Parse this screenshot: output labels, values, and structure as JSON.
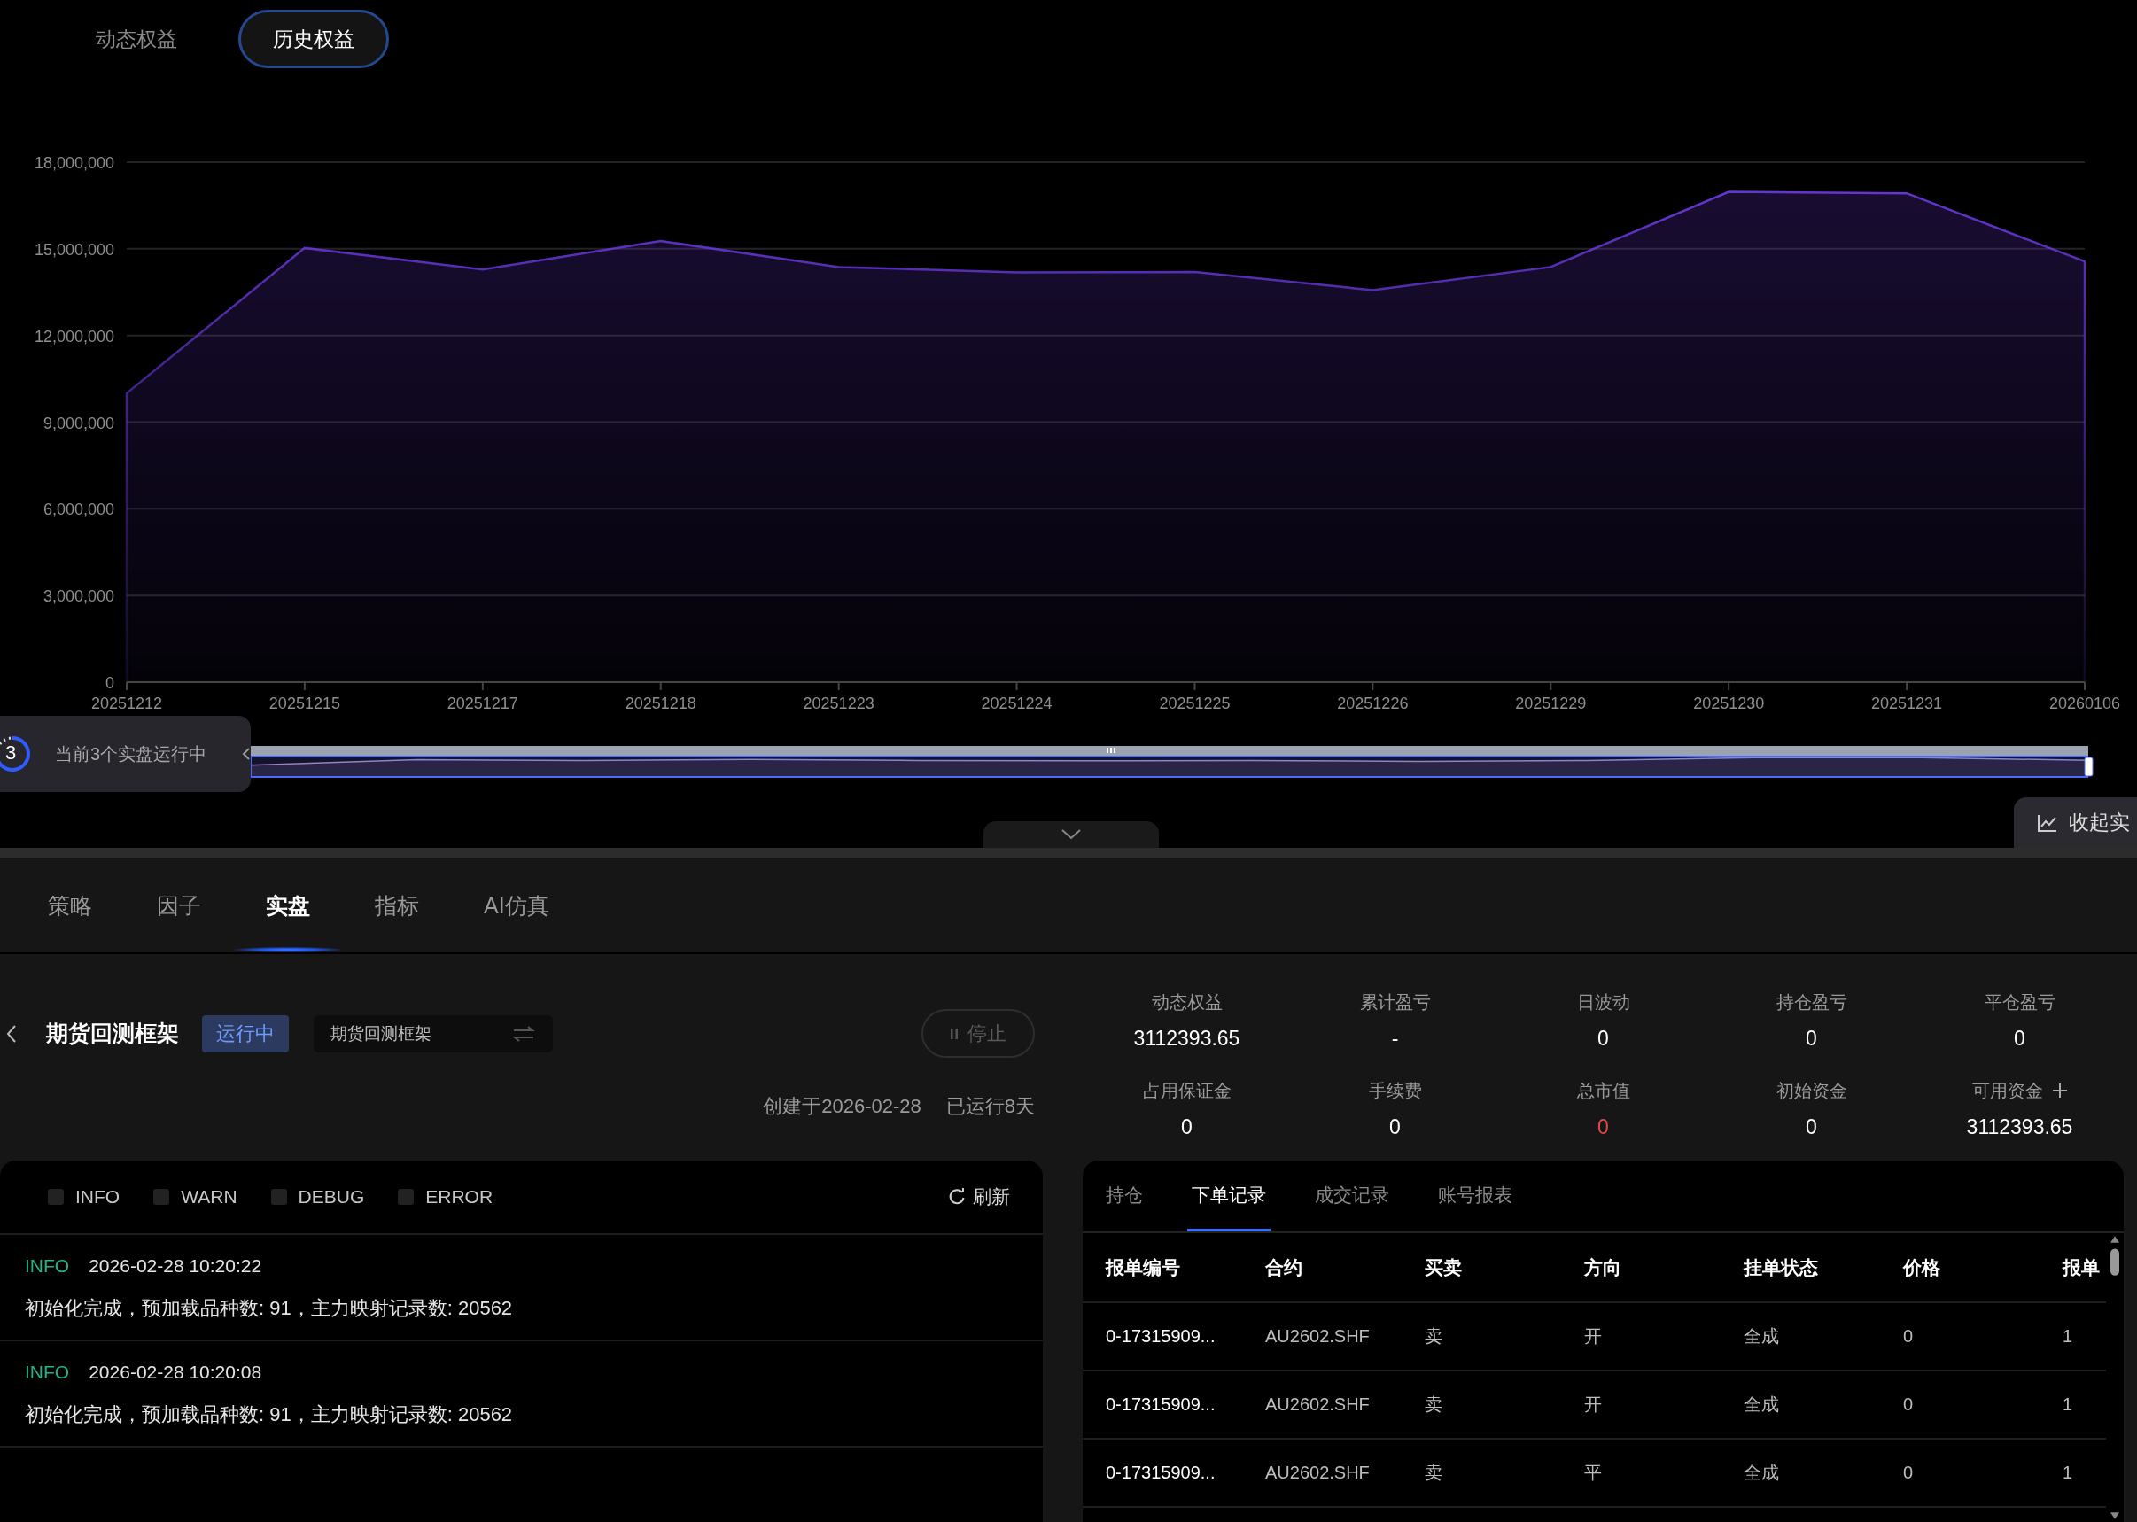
{
  "view_toggle": [
    {
      "label": "动态权益",
      "selected": false
    },
    {
      "label": "历史权益",
      "selected": true
    }
  ],
  "equity_chart": {
    "chart_data": {
      "type": "area",
      "categories": [
        "20251212",
        "20251215",
        "20251217",
        "20251218",
        "20251223",
        "20251224",
        "20251225",
        "20251226",
        "20251229",
        "20251230",
        "20251231",
        "20260106"
      ],
      "series": [
        {
          "color": "#6f3be6",
          "values": [
            10000000,
            15030000,
            14280000,
            15270000,
            14370000,
            14180000,
            14200000,
            13570000,
            14370000,
            16970000,
            16920000,
            14560000
          ]
        }
      ],
      "ylim": [
        0,
        18000000
      ],
      "grid": true,
      "yticks": [
        {
          "value": 0,
          "label": "0"
        },
        {
          "value": 3000000,
          "label": "3,000,000"
        },
        {
          "value": 6000000,
          "label": "6,000,000"
        },
        {
          "value": 9000000,
          "label": "9,000,000"
        },
        {
          "value": 12000000,
          "label": "12,000,000"
        },
        {
          "value": 15000000,
          "label": "15,000,000"
        },
        {
          "value": 18000000,
          "label": "18,000,000"
        }
      ]
    }
  },
  "zoom_slider": {
    "level": 1
  },
  "running_badge": {
    "count": "3",
    "text": "当前3个实盘运行中"
  },
  "collapse_button": {
    "label": "收起实"
  },
  "nav_tabs": [
    {
      "label": "策略",
      "selected": false
    },
    {
      "label": "因子",
      "selected": false
    },
    {
      "label": "实盘",
      "selected": true
    },
    {
      "label": "指标",
      "selected": false
    },
    {
      "label": "AI仿真",
      "selected": false
    }
  ],
  "strategy": {
    "name": "期货回测框架",
    "status": "运行中",
    "selector_value": "期货回测框架",
    "stop_label": "停止",
    "created": "创建于2026-02-28",
    "runtime": "已运行8天"
  },
  "stats": [
    {
      "label": "动态权益",
      "value": "3112393.65",
      "negative": false,
      "addable": false
    },
    {
      "label": "累计盈亏",
      "value": "-",
      "negative": false,
      "addable": false
    },
    {
      "label": "日波动",
      "value": "0",
      "negative": false,
      "addable": false
    },
    {
      "label": "持仓盈亏",
      "value": "0",
      "negative": false,
      "addable": false
    },
    {
      "label": "平仓盈亏",
      "value": "0",
      "negative": false,
      "addable": false
    },
    {
      "label": "占用保证金",
      "value": "0",
      "negative": false,
      "addable": false
    },
    {
      "label": "手续费",
      "value": "0",
      "negative": false,
      "addable": false
    },
    {
      "label": "总市值",
      "value": "0",
      "negative": true,
      "addable": false
    },
    {
      "label": "初始资金",
      "value": "0",
      "negative": false,
      "addable": false
    },
    {
      "label": "可用资金",
      "value": "3112393.65",
      "negative": false,
      "addable": true
    }
  ],
  "log_panel": {
    "filters": [
      {
        "label": "INFO",
        "checked": false
      },
      {
        "label": "WARN",
        "checked": false
      },
      {
        "label": "DEBUG",
        "checked": false
      },
      {
        "label": "ERROR",
        "checked": false
      }
    ],
    "refresh_label": "刷新",
    "entries": [
      {
        "level": "INFO",
        "time": "2026-02-28 10:20:22",
        "message": "初始化完成，预加载品种数: 91，主力映射记录数: 20562"
      },
      {
        "level": "INFO",
        "time": "2026-02-28 10:20:08",
        "message": "初始化完成，预加载品种数: 91，主力映射记录数: 20562"
      }
    ]
  },
  "orders_panel": {
    "tabs": [
      {
        "label": "持仓",
        "selected": false
      },
      {
        "label": "下单记录",
        "selected": true
      },
      {
        "label": "成交记录",
        "selected": false
      },
      {
        "label": "账号报表",
        "selected": false
      }
    ],
    "columns": [
      "报单编号",
      "合约",
      "买卖",
      "方向",
      "挂单状态",
      "价格",
      "报单"
    ],
    "rows": [
      [
        "0-17315909...",
        "AU2602.SHF",
        "卖",
        "开",
        "全成",
        "0",
        "1"
      ],
      [
        "0-17315909...",
        "AU2602.SHF",
        "卖",
        "开",
        "全成",
        "0",
        "1"
      ],
      [
        "0-17315909...",
        "AU2602.SHF",
        "卖",
        "平",
        "全成",
        "0",
        "1"
      ]
    ]
  }
}
